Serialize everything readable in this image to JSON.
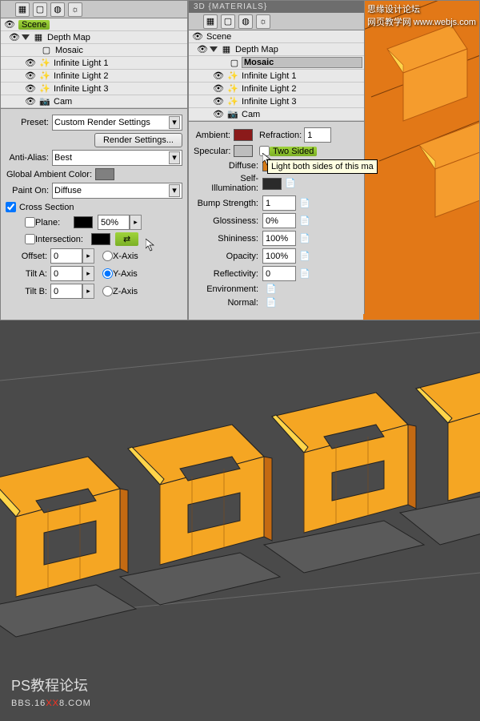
{
  "watermarks": {
    "top_cn": "思缘设计论坛",
    "top_sub": "网页教学网",
    "top_url": "www.webjs.com",
    "bottom_cn": "PS教程论坛",
    "bottom_url_pre": "BBS.16",
    "bottom_url_mid": "XX",
    "bottom_url_post": "8.COM"
  },
  "left": {
    "scene_root": "Scene",
    "depth_map": "Depth Map",
    "mosaic": "Mosaic",
    "light1": "Infinite Light 1",
    "light2": "Infinite Light 2",
    "light3": "Infinite Light 3",
    "cam": "Cam",
    "preset_label": "Preset:",
    "preset_value": "Custom Render Settings",
    "render_btn": "Render Settings...",
    "aa_label": "Anti-Alias:",
    "aa_value": "Best",
    "gac_label": "Global Ambient Color:",
    "painton_label": "Paint On:",
    "painton_value": "Diffuse",
    "cross_section": "Cross Section",
    "plane": "Plane:",
    "plane_val": "50%",
    "intersection": "Intersection:",
    "offset": "Offset:",
    "offset_val": "0",
    "tilta": "Tilt A:",
    "tilta_val": "0",
    "tiltb": "Tilt B:",
    "tiltb_val": "0",
    "xaxis": "X-Axis",
    "yaxis": "Y-Axis",
    "zaxis": "Z-Axis"
  },
  "right": {
    "title": "3D {MATERIALS}",
    "scene_root": "Scene",
    "depth_map": "Depth Map",
    "mosaic": "Mosaic",
    "light1": "Infinite Light 1",
    "light2": "Infinite Light 2",
    "light3": "Infinite Light 3",
    "cam": "Cam",
    "ambient": "Ambient:",
    "refraction": "Refraction:",
    "refraction_val": "1",
    "specular": "Specular:",
    "twosided": "Two Sided",
    "tooltip": "Light both sides of this ma",
    "diffuse": "Diffuse:",
    "selfillum": "Self-Illumination:",
    "bump": "Bump Strength:",
    "bump_val": "1",
    "gloss": "Glossiness:",
    "gloss_val": "0%",
    "shine": "Shininess:",
    "shine_val": "100%",
    "opacity": "Opacity:",
    "opacity_val": "100%",
    "reflect": "Reflectivity:",
    "reflect_val": "0",
    "env": "Environment:",
    "normal": "Normal:"
  }
}
